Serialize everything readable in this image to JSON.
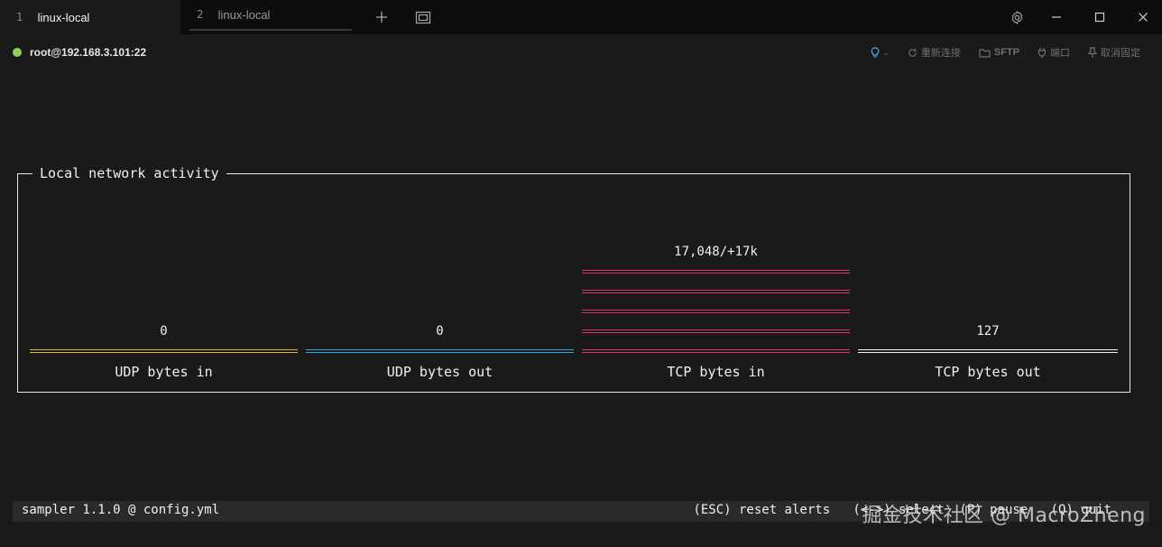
{
  "tabs": [
    {
      "number": "1",
      "label": "linux-local",
      "active": true
    },
    {
      "number": "2",
      "label": "linux-local",
      "active": false
    }
  ],
  "session": {
    "host": "root@192.168.3.101:22",
    "status_color": "#8bd15e"
  },
  "actions": {
    "reconnect": "重新连接",
    "sftp": "SFTP",
    "port": "端口",
    "unpin": "取消固定"
  },
  "panel": {
    "title": "Local network activity",
    "gauges": [
      {
        "label": "UDP bytes in",
        "value": "0",
        "color": "#e0b040",
        "level": 0
      },
      {
        "label": "UDP bytes out",
        "value": "0",
        "color": "#3aa8e0",
        "level": 0
      },
      {
        "label": "TCP bytes in",
        "value": "17,048/+17k",
        "color": "#e0307a",
        "level": 5
      },
      {
        "label": "TCP bytes out",
        "value": "127",
        "color": "#f0f0f0",
        "level": 0
      }
    ]
  },
  "statusbar": {
    "left": "sampler 1.1.0 @ config.yml",
    "right": "(ESC) reset alerts   (<->) select  (P) pause   (Q) quit"
  },
  "watermark": "掘金技术社区 @ MacroZheng",
  "icons": {
    "new_tab": "plus-icon",
    "tab_overview": "tabs-icon",
    "settings": "gear-icon",
    "minimize": "minimize-icon",
    "maximize": "maximize-icon",
    "close": "close-icon",
    "tips": "lightbulb-icon",
    "reconnect": "refresh-icon",
    "sftp": "folder-icon",
    "port": "plug-icon",
    "unpin": "pin-icon"
  }
}
